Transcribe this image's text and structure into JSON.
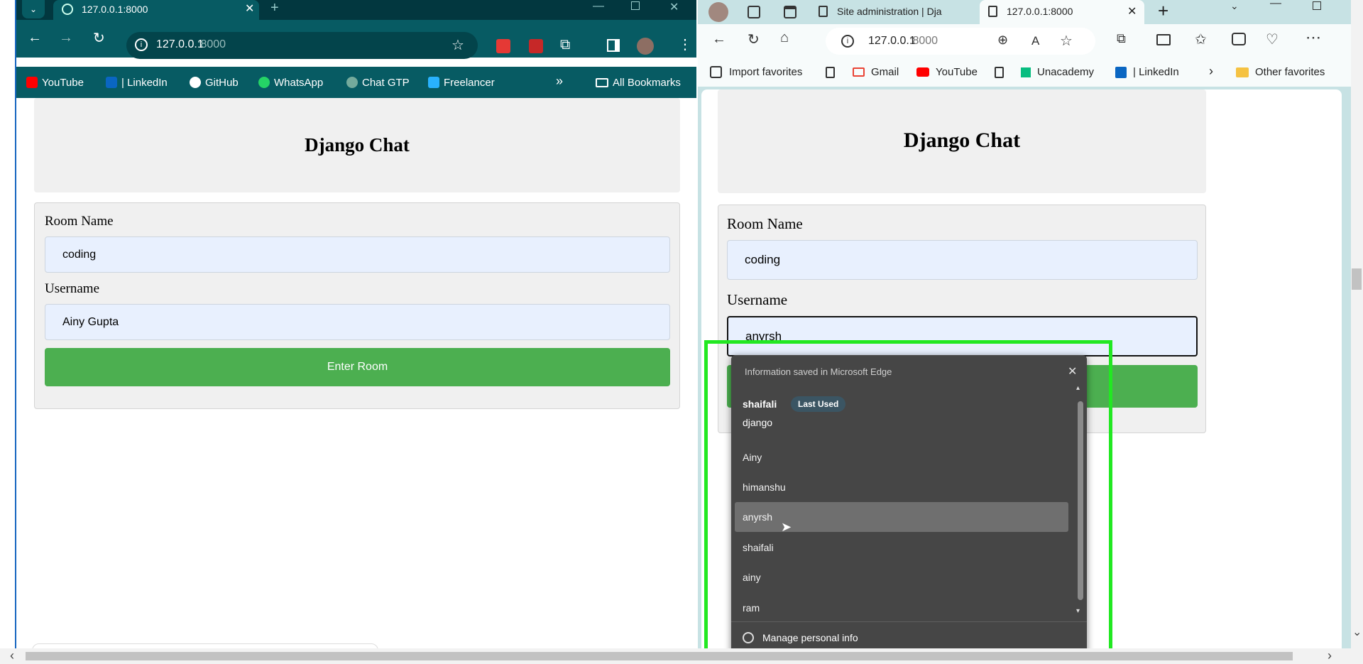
{
  "chrome": {
    "tab_title": "127.0.0.1:8000",
    "url_host": "127.0.0.1",
    "url_port": ":8000",
    "bookmarks": [
      "YouTube",
      "| LinkedIn",
      "GitHub",
      "WhatsApp",
      "Chat GTP",
      "Freelancer"
    ],
    "all_bookmarks": "All Bookmarks",
    "more": "»"
  },
  "edge": {
    "tabs": [
      "Site administration | Dja",
      "127.0.0.1:8000"
    ],
    "url_host": "127.0.0.1",
    "url_port": ":8000",
    "read_aloud": "A",
    "bookmarks": [
      "Import favorites",
      "Gmail",
      "YouTube",
      "Unacademy",
      "| LinkedIn"
    ],
    "other_favorites": "Other favorites"
  },
  "app_left": {
    "title": "Django Chat",
    "room_label": "Room Name",
    "room_value": "coding",
    "user_label": "Username",
    "user_value": "Ainy Gupta",
    "button": "Enter Room"
  },
  "app_right": {
    "title": "Django Chat",
    "room_label": "Room Name",
    "room_value": "coding",
    "user_label": "Username",
    "user_value": "anyrsh"
  },
  "autofill": {
    "header": "Information saved in Microsoft Edge",
    "first_user": "shaifali",
    "badge": "Last Used",
    "first_value": "django",
    "items": [
      "Ainy",
      "himanshu",
      "anyrsh",
      "shaifali",
      "ainy",
      "ram"
    ],
    "selected_index": 2,
    "manage": "Manage personal info"
  },
  "colors": {
    "chrome_frame": "#075b63",
    "edge_frame": "#c7e2e4",
    "enter_button": "#4caf50",
    "highlight": "#22e822"
  }
}
